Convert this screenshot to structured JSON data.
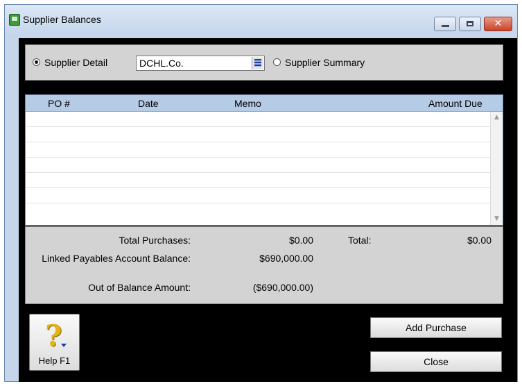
{
  "window": {
    "title": "Supplier Balances",
    "controls": {
      "minimize_icon": "minimize-icon",
      "maximize_icon": "maximize-icon",
      "close_glyph": "✕"
    }
  },
  "filter": {
    "detail_label": "Supplier Detail",
    "detail_selected": true,
    "supplier_value": "DCHL.Co.",
    "summary_label": "Supplier Summary",
    "summary_selected": false
  },
  "table": {
    "columns": [
      "PO #",
      "Date",
      "Memo",
      "Amount Due"
    ],
    "rows": []
  },
  "totals": {
    "total_purchases_label": "Total Purchases:",
    "total_purchases_value": "$0.00",
    "total_label": "Total:",
    "total_value": "$0.00",
    "linked_label": "Linked Payables Account Balance:",
    "linked_value": "$690,000.00",
    "out_of_balance_label": "Out of Balance Amount:",
    "out_of_balance_value": "($690,000.00)"
  },
  "buttons": {
    "help_label": "Help F1",
    "help_glyph": "?",
    "add_purchase": "Add Purchase",
    "close": "Close"
  },
  "colors": {
    "title_bar": "#c4d6ec",
    "table_header": "#b6cbe6",
    "panel": "#d3d3d3",
    "frame": "#000000",
    "help_icon": "#e3b318"
  }
}
